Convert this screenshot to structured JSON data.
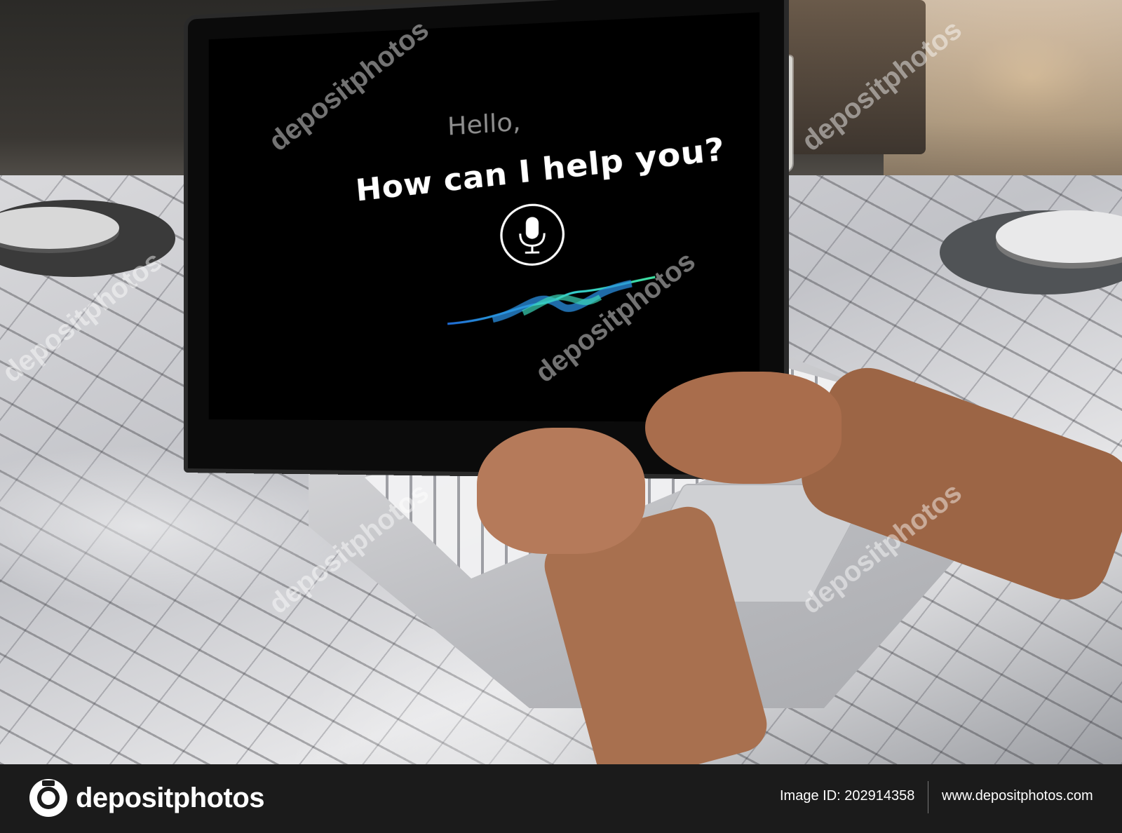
{
  "screen": {
    "greeting": "Hello,",
    "prompt": "How can I help you?",
    "mic_icon": "microphone-icon",
    "waveform_colors": [
      "#1f6bd6",
      "#33c7d8",
      "#3ee0a0"
    ]
  },
  "watermark": {
    "text": "depositphotos"
  },
  "footer": {
    "logo_text": "depositphotos",
    "logo_icon": "camera-logo-icon",
    "image_id": "Image ID: 202914358",
    "url": "www.depositphotos.com"
  },
  "colors": {
    "footer_bg": "#1b1b1b",
    "screen_bg": "#000000",
    "prompt_text": "#ffffff",
    "greeting_text": "#8e8e8e"
  }
}
